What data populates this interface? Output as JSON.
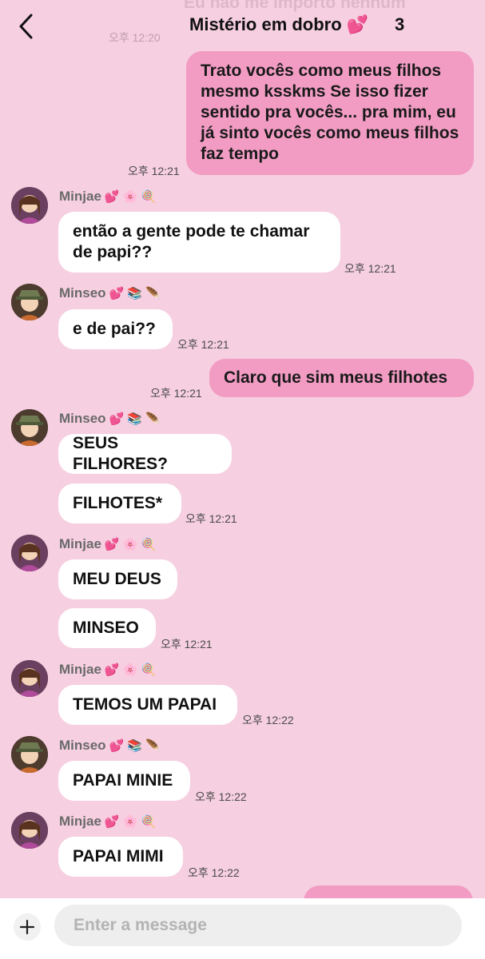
{
  "header": {
    "ghost_text": "Eu não me importo nenhum",
    "ghost_time": "오후 12:20",
    "title": "Mistério em dobro 💕",
    "member_count": "3"
  },
  "colors": {
    "background": "#f6cfe0",
    "outgoing_bubble": "#f29cc4",
    "incoming_bubble": "#ffffff"
  },
  "messages": [
    {
      "dir": "out",
      "text": "Trato vocês como meus filhos mesmo ksskms Se isso fizer sentido pra vocês... pra mim, eu já sinto vocês como meus filhos faz tempo",
      "time": "오후 12:21"
    },
    {
      "dir": "in",
      "sender": "Minjae",
      "sender_emoji": "💕 🌸 🍭",
      "text": "então a gente pode te chamar de papi??",
      "time": "오후 12:21"
    },
    {
      "dir": "in",
      "sender": "Minseo",
      "sender_emoji": "💕 📚 🪶",
      "text": "e de pai??",
      "time": "오후 12:21"
    },
    {
      "dir": "out",
      "text": "Claro que sim meus filhotes",
      "time": "오후 12:21"
    },
    {
      "dir": "in",
      "sender": "Minseo",
      "sender_emoji": "💕 📚 🪶",
      "text": "SEUS FILHORES?"
    },
    {
      "dir": "in",
      "text": "FILHOTES*",
      "time": "오후 12:21"
    },
    {
      "dir": "in",
      "sender": "Minjae",
      "sender_emoji": "💕 🌸 🍭",
      "text": "MEU DEUS"
    },
    {
      "dir": "in",
      "text": "MINSEO",
      "time": "오후 12:21"
    },
    {
      "dir": "in",
      "sender": "Minjae",
      "sender_emoji": "💕 🌸 🍭",
      "text": "TEMOS UM PAPAI",
      "time": "오후 12:22"
    },
    {
      "dir": "in",
      "sender": "Minseo",
      "sender_emoji": "💕 📚 🪶",
      "text": "PAPAI MINIE",
      "time": "오후 12:22"
    },
    {
      "dir": "in",
      "sender": "Minjae",
      "sender_emoji": "💕 🌸 🍭",
      "text": "PAPAI MIMI",
      "time": "오후 12:22"
    }
  ],
  "composer": {
    "placeholder": "Enter a message"
  }
}
